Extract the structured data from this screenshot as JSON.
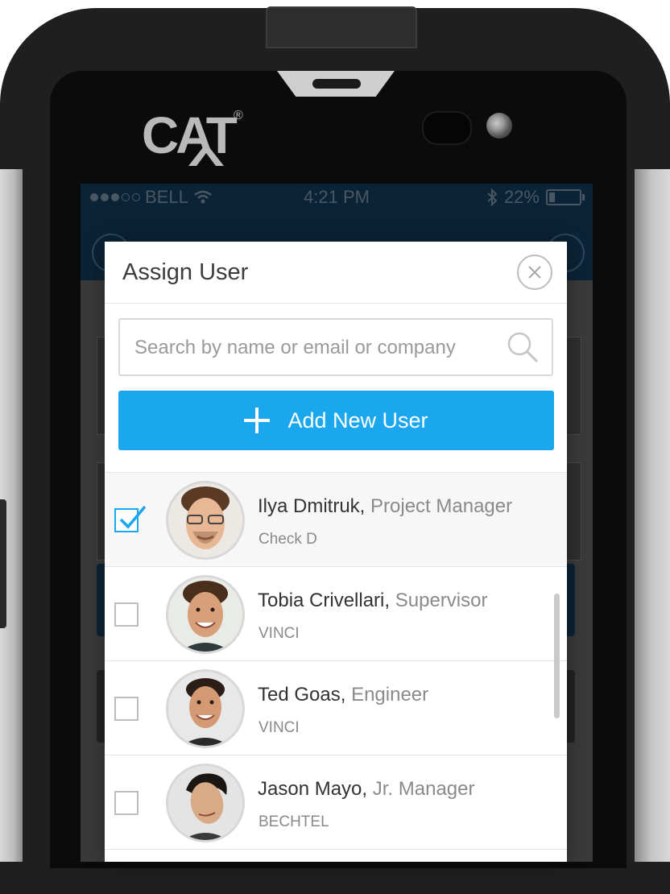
{
  "device": {
    "brand_logo": "CAT",
    "registered_mark": "®"
  },
  "status_bar": {
    "carrier": "BELL",
    "time": "4:21 PM",
    "battery": "22%",
    "battery_level": 0.22,
    "signal_bars_filled": 3,
    "signal_bars_total": 5
  },
  "modal": {
    "title": "Assign User",
    "search_placeholder": "Search by name or email or company",
    "add_button_label": "Add New User"
  },
  "users": [
    {
      "name": "Ilya Dmitruk,",
      "role": "Project Manager",
      "company": "Check D",
      "selected": true
    },
    {
      "name": "Tobia Crivellari,",
      "role": "Supervisor",
      "company": "VINCI",
      "selected": false
    },
    {
      "name": "Ted Goas,",
      "role": "Engineer",
      "company": "VINCI",
      "selected": false
    },
    {
      "name": "Jason Mayo,",
      "role": "Jr. Manager",
      "company": "BECHTEL",
      "selected": false
    }
  ],
  "colors": {
    "accent": "#1ba7ed",
    "header_bg": "#0b2336"
  },
  "icons": [
    "close-icon",
    "search-icon",
    "plus-icon",
    "check-icon",
    "wifi-icon",
    "bluetooth-icon",
    "battery-icon"
  ]
}
